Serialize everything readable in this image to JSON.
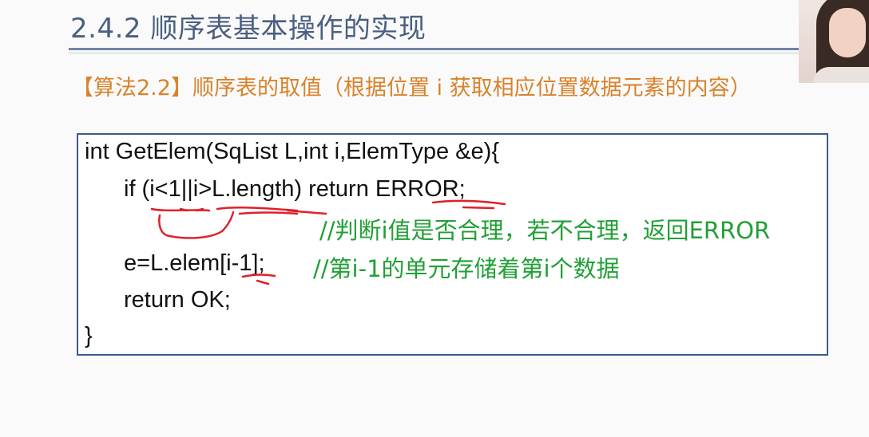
{
  "slide": {
    "title": "2.4.2 顺序表基本操作的实现",
    "heading": "【算法2.2】顺序表的取值（根据位置 i 获取相应位置数据元素的内容）"
  },
  "code": {
    "line1": "int GetElem(SqList L,int i,ElemType &e){",
    "line2": "if (i<1||i>L.length) return ERROR;",
    "comment1": "//判断i值是否合理，若不合理，返回ERROR",
    "line3": "e=L.elem[i-1];",
    "comment2": "//第i-1的单元存储着第i个数据",
    "line4": "return OK;",
    "line5": "}"
  },
  "colors": {
    "title": "#4a5f80",
    "heading": "#d9822b",
    "comment": "#21a036",
    "annotation": "#e0202a",
    "box_border": "#3e5c8a"
  },
  "webcam": {
    "icon": "presenter-video"
  }
}
